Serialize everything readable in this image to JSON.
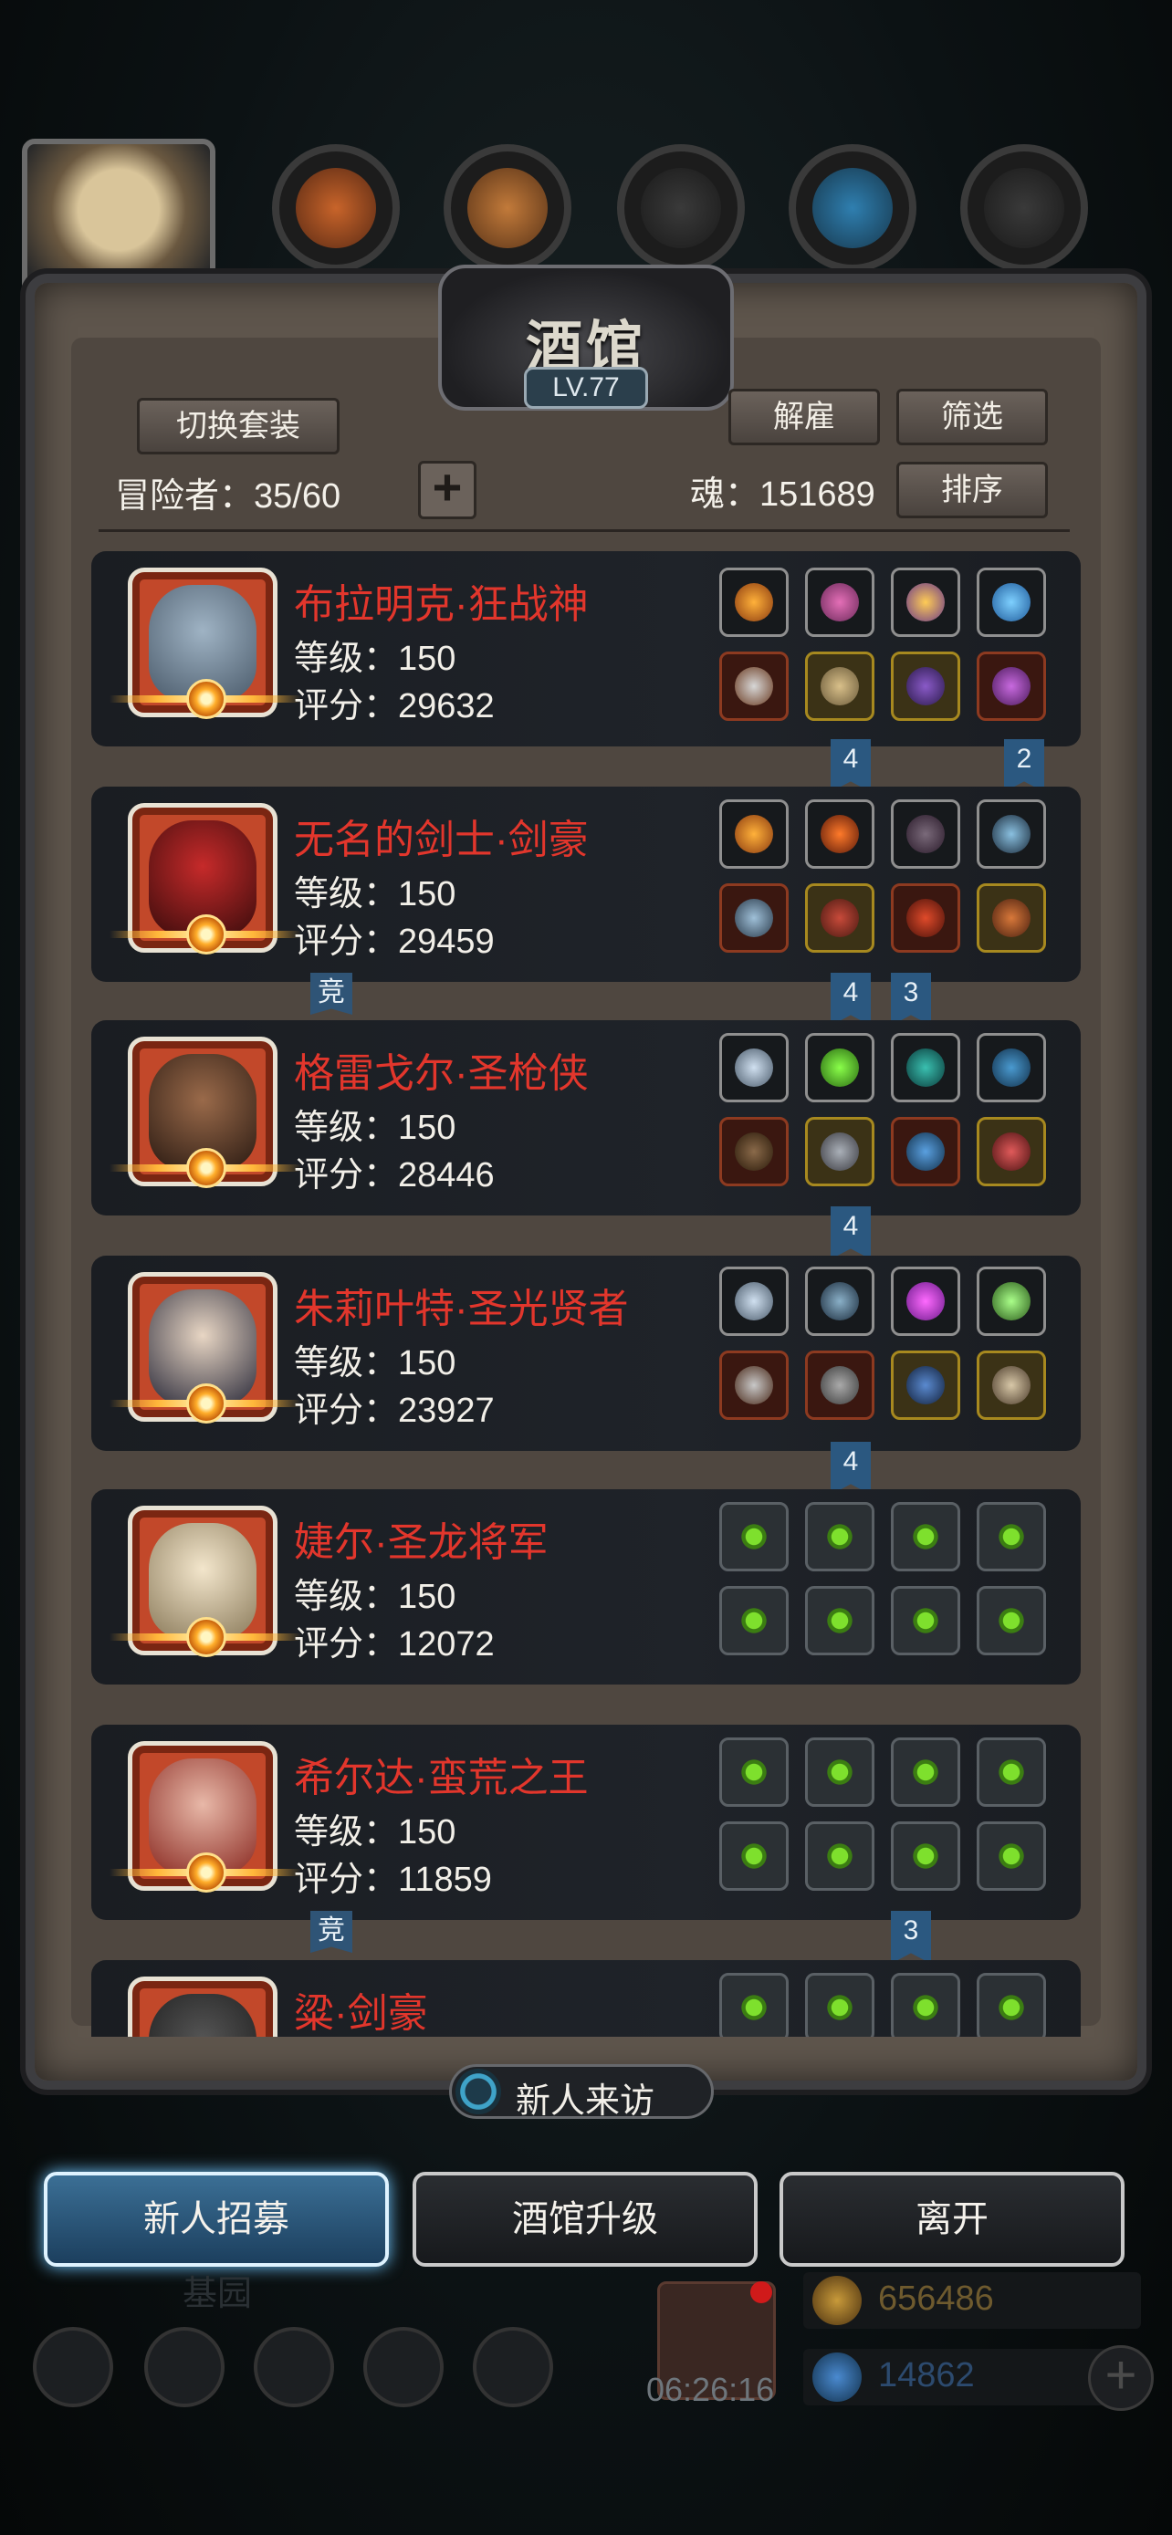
{
  "title": "酒馆",
  "level": "LV.77",
  "header": {
    "switch_suit": "切换套装",
    "fire": "解雇",
    "filter": "筛选",
    "sort": "排序",
    "adventurers_label": "冒险者：35/60",
    "soul_label": "魂：151689"
  },
  "heroes": [
    {
      "name": "布拉明克·狂战神",
      "level": "等级：150",
      "score": "评分：29632",
      "face": "#7d8fa0"
    },
    {
      "name": "无名的剑士·剑豪",
      "level": "等级：150",
      "score": "评分：29459",
      "face": "#9a1e1e"
    },
    {
      "name": "格雷戈尔·圣枪侠",
      "level": "等级：150",
      "score": "评分：28446",
      "face": "#6a4a32"
    },
    {
      "name": "朱莉叶特·圣光贤者",
      "level": "等级：150",
      "score": "评分：23927",
      "face": "#d9c7b6"
    },
    {
      "name": "婕尔·圣龙将军",
      "level": "等级：150",
      "score": "评分：12072",
      "face": "#e6d6b0"
    },
    {
      "name": "希尔达·蛮荒之王",
      "level": "等级：150",
      "score": "评分：11859",
      "face": "#b8413a"
    },
    {
      "name": "粱·剑豪",
      "level": "",
      "score": "",
      "face": "#444"
    }
  ],
  "set_tags": {
    "row1_a": "4",
    "row1_b": "2",
    "row2_a": "4",
    "row2_b": "3",
    "row3_a": "4",
    "row4_a": "4",
    "row6_b": "3",
    "compete": "竞"
  },
  "visit_label": "新人来访",
  "buttons": {
    "recruit": "新人招募",
    "upgrade": "酒馆升级",
    "leave": "离开"
  },
  "bottom": {
    "gold": "656486",
    "gems": "14862",
    "timer": "06:26:16",
    "dim_label": "基园"
  }
}
